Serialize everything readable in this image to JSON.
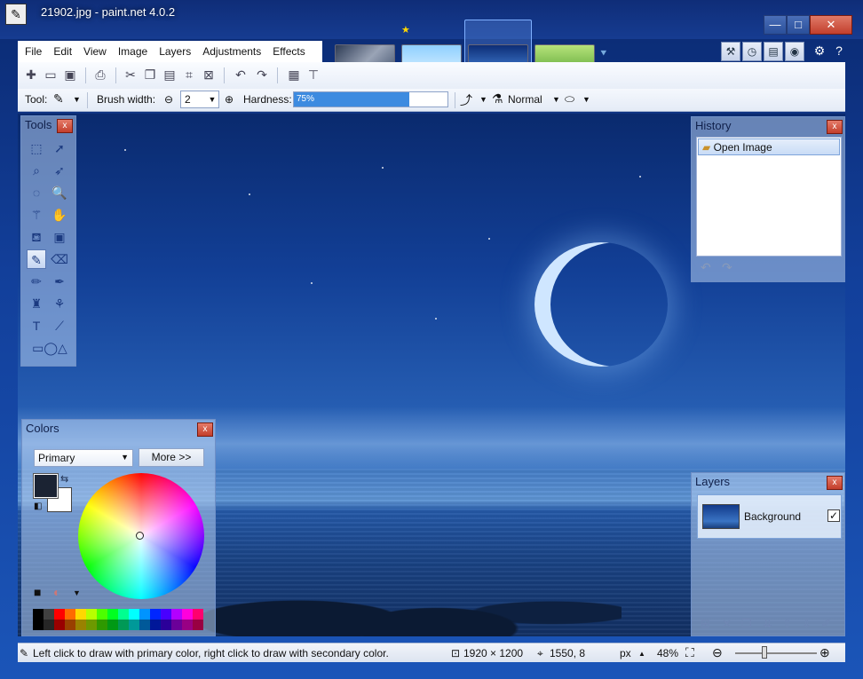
{
  "window": {
    "title": "21902.jpg - paint.net 4.0.2",
    "minimize_label": "—",
    "maximize_label": "□",
    "close_label": "✕"
  },
  "menu": [
    "File",
    "Edit",
    "View",
    "Image",
    "Layers",
    "Adjustments",
    "Effects"
  ],
  "toolbar2": {
    "tool_label": "Tool:",
    "brush_width_label": "Brush width:",
    "brush_width_value": "2",
    "hardness_label": "Hardness:",
    "hardness_value": "75%",
    "hardness_fraction": 0.75,
    "blend_mode": "Normal"
  },
  "tools_panel": {
    "title": "Tools",
    "close": "x"
  },
  "history_panel": {
    "title": "History",
    "close": "x",
    "items": [
      "Open Image"
    ]
  },
  "colors_panel": {
    "title": "Colors",
    "close": "x",
    "selector_value": "Primary",
    "more_button": "More >>",
    "primary_color": "#1b2333",
    "secondary_color": "#ffffff"
  },
  "layers_panel": {
    "title": "Layers",
    "close": "x",
    "layers": [
      {
        "name": "Background",
        "visible": true
      }
    ]
  },
  "statusbar": {
    "hint": "Left click to draw with primary color, right click to draw with secondary color.",
    "image_size": "1920 × 1200",
    "cursor_pos": "1550, 8",
    "unit": "px",
    "zoom": "48%"
  },
  "palette": [
    "#000000",
    "#404040",
    "#ff0000",
    "#ff6a00",
    "#ffd800",
    "#b6ff00",
    "#4cff00",
    "#00ff21",
    "#00ff90",
    "#00ffff",
    "#0094ff",
    "#0026ff",
    "#4800ff",
    "#b200ff",
    "#ff00dc",
    "#ff006e"
  ]
}
